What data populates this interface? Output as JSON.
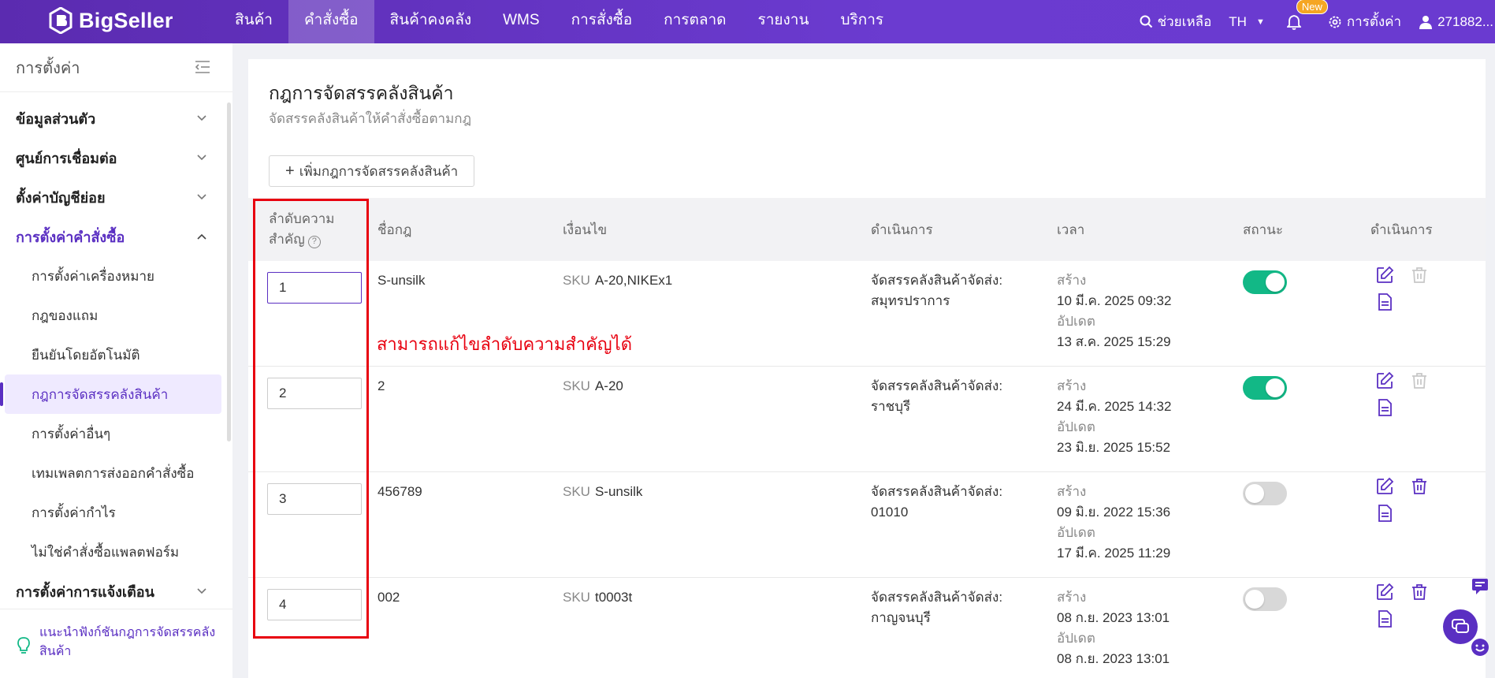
{
  "brand": "BigSeller",
  "nav": [
    {
      "label": "สินค้า",
      "active": false
    },
    {
      "label": "คำสั่งซื้อ",
      "active": true
    },
    {
      "label": "สินค้าคงคลัง",
      "active": false
    },
    {
      "label": "WMS",
      "active": false
    },
    {
      "label": "การสั่งซื้อ",
      "active": false
    },
    {
      "label": "การตลาด",
      "active": false
    },
    {
      "label": "รายงาน",
      "active": false
    },
    {
      "label": "บริการ",
      "active": false
    }
  ],
  "topright": {
    "help": "ช่วยเหลือ",
    "lang": "TH",
    "new_badge": "New",
    "settings": "การตั้งค่า",
    "user": "271882..."
  },
  "sidebar": {
    "title": "การตั้งค่า",
    "groups": [
      {
        "label": "ข้อมูลส่วนตัว"
      },
      {
        "label": "ศูนย์การเชื่อมต่อ"
      },
      {
        "label": "ตั้งค่าบัญชีย่อย"
      },
      {
        "label": "การตั้งค่าคำสั่งซื้อ"
      }
    ],
    "subitems": [
      {
        "label": "การตั้งค่าเครื่องหมาย"
      },
      {
        "label": "กฎของแถม"
      },
      {
        "label": "ยืนยันโดยอัตโนมัติ"
      },
      {
        "label": "กฎการจัดสรรคลังสินค้า"
      },
      {
        "label": "การตั้งค่าอื่นๆ"
      },
      {
        "label": "เทมเพลตการส่งออกคำสั่งซื้อ"
      },
      {
        "label": "การตั้งค่ากำไร"
      },
      {
        "label": "ไม่ใช่คำสั่งซื้อแพลตฟอร์ม"
      }
    ],
    "last_group": "การตั้งค่าการแจ้งเตือน",
    "footer_line1": "แนะนำฟังก์ชันกฎการจัดสรรคลัง",
    "footer_line2": "สินค้า"
  },
  "main": {
    "title": "กฎการจัดสรรคลังสินค้า",
    "subtitle": "จัดสรรคลังสินค้าให้คำสั่งซื้อตามกฎ",
    "add_button": "เพิ่มกฎการจัดสรรคลังสินค้า",
    "columns": {
      "priority_l1": "ลำดับความ",
      "priority_l2": "สำคัญ",
      "rule_name": "ชื่อกฎ",
      "condition": "เงื่อนไข",
      "operation": "ดำเนินการ",
      "time": "เวลา",
      "status": "สถานะ",
      "actions": "ดำเนินการ"
    },
    "sku_label": "SKU",
    "created_label": "สร้าง",
    "updated_label": "อัปเดต",
    "op_prefix": "จัดสรรคลังสินค้าจัดส่ง:",
    "rows": [
      {
        "priority": "1",
        "name": "S-unsilk",
        "sku": "A-20,NIKEx1",
        "warehouse": "สมุทรปราการ",
        "created": "10 มี.ค. 2025 09:32",
        "updated": "13 ส.ค. 2025 15:29",
        "enabled": true
      },
      {
        "priority": "2",
        "name": "2",
        "sku": "A-20",
        "warehouse": "ราชบุรี",
        "created": "24 มี.ค. 2025 14:32",
        "updated": "23 มิ.ย. 2025 15:52",
        "enabled": true
      },
      {
        "priority": "3",
        "name": "456789",
        "sku": "S-unsilk",
        "warehouse": "01010",
        "created": "09 มิ.ย. 2022 15:36",
        "updated": "17 มี.ค. 2025 11:29",
        "enabled": false
      },
      {
        "priority": "4",
        "name": "002",
        "sku": "t0003t",
        "warehouse": "กาญจนบุรี",
        "created": "08 ก.ย. 2023 13:01",
        "updated": "08 ก.ย. 2023 13:01",
        "enabled": false
      }
    ]
  },
  "annotation": "สามารถแก้ไขลำดับความสำคัญได้",
  "colors": {
    "accent": "#5a2fc2",
    "toggle_on": "#12b886",
    "annotation": "#e8000f"
  }
}
